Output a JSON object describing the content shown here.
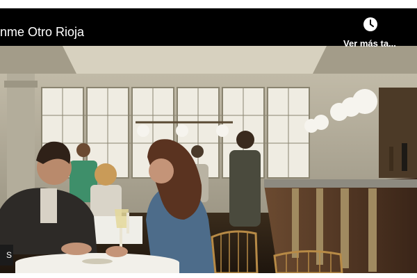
{
  "video": {
    "title": "nme Otro Rioja",
    "watch_later_label": "Ver más ta...",
    "watch_later_icon": "clock-icon",
    "corner_badge": "S"
  },
  "colors": {
    "overlay": "#000000",
    "text": "#ffffff",
    "scene_wall": "#c9c4b5",
    "scene_floor": "#2f2418",
    "bar_counter": "#5a3a25"
  }
}
